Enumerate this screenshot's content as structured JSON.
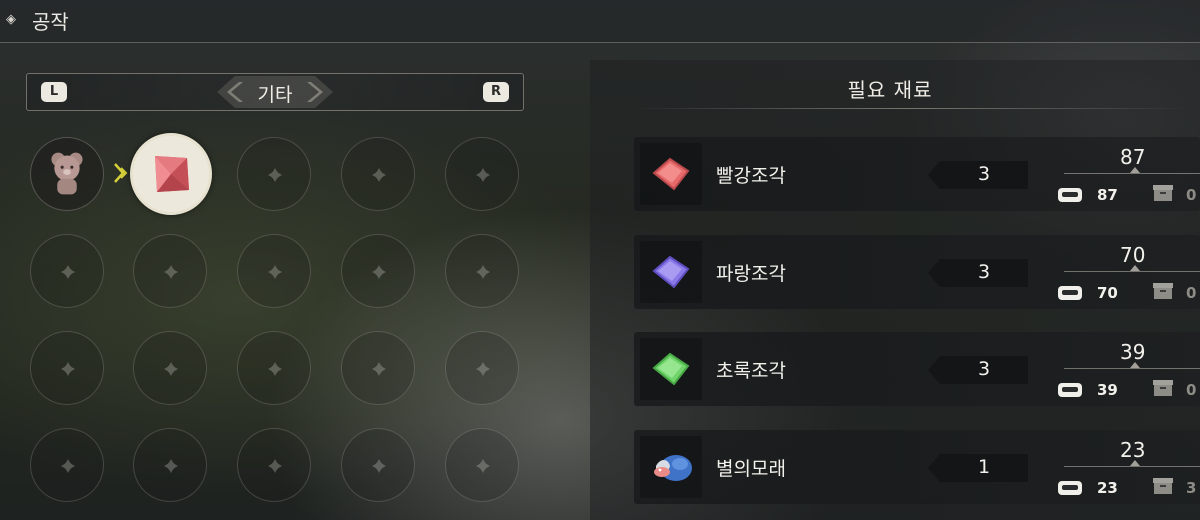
{
  "header": {
    "title": "공작",
    "icon": "diamond-icon"
  },
  "category": {
    "label": "기타",
    "prev_key": "L",
    "next_key": "R"
  },
  "panel": {
    "title": "필요 재료"
  },
  "materials": [
    {
      "name": "빨강조각",
      "required": "3",
      "owned": "87",
      "inventory": "87",
      "storage": "0",
      "color": "#e86a6a",
      "icon": "red-fragment-icon"
    },
    {
      "name": "파랑조각",
      "required": "3",
      "owned": "70",
      "inventory": "70",
      "storage": "0",
      "color": "#8a78e8",
      "icon": "blue-fragment-icon"
    },
    {
      "name": "초록조각",
      "required": "3",
      "owned": "39",
      "inventory": "39",
      "storage": "0",
      "color": "#6fd46a",
      "icon": "green-fragment-icon"
    },
    {
      "name": "별의모래",
      "required": "1",
      "owned": "23",
      "inventory": "23",
      "storage": "3",
      "color": "#3f73c8",
      "icon": "star-sand-pouch-icon"
    }
  ]
}
